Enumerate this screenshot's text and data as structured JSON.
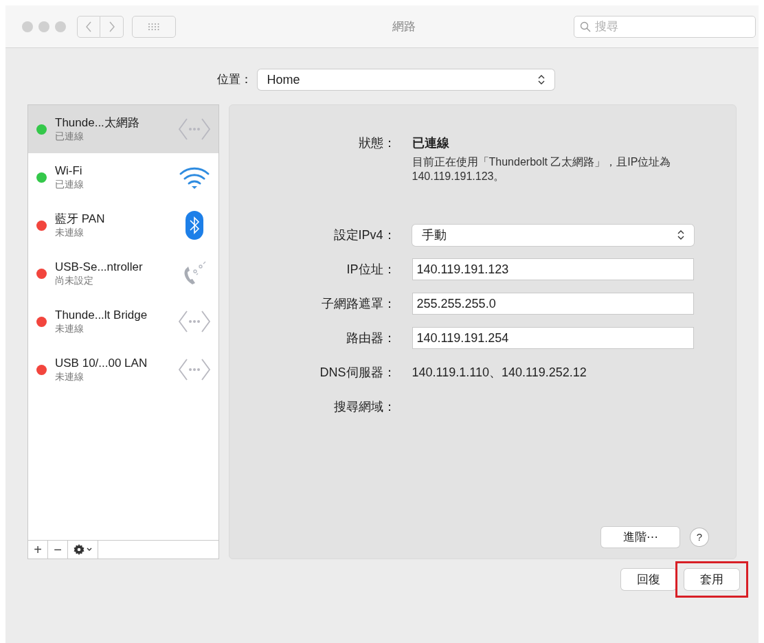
{
  "window": {
    "title": "網路",
    "search": {
      "placeholder": "搜尋"
    }
  },
  "location": {
    "label": "位置：",
    "value": "Home"
  },
  "services": [
    {
      "name": "Thunde...太網路",
      "status": "已連線",
      "color": "#34c84a",
      "selected": true,
      "kind": "ethernet"
    },
    {
      "name": "Wi-Fi",
      "status": "已連線",
      "color": "#34c84a",
      "selected": false,
      "kind": "wifi"
    },
    {
      "name": "藍牙 PAN",
      "status": "未連線",
      "color": "#f2453d",
      "selected": false,
      "kind": "bluetooth"
    },
    {
      "name": "USB-Se...ntroller",
      "status": "尚未設定",
      "color": "#f2453d",
      "selected": false,
      "kind": "phone"
    },
    {
      "name": "Thunde...lt Bridge",
      "status": "未連線",
      "color": "#f2453d",
      "selected": false,
      "kind": "ethernet"
    },
    {
      "name": "USB 10/...00 LAN",
      "status": "未連線",
      "color": "#f2453d",
      "selected": false,
      "kind": "ethernet"
    }
  ],
  "service_toolbar": [
    "+",
    "−"
  ],
  "detail": {
    "status_label": "狀態：",
    "status_value": "已連線",
    "description": "目前正在使用「Thunderbolt 乙太網路」，且IP位址為140.119.191.123。",
    "fields": [
      {
        "label": "設定IPv4：",
        "value": "手動",
        "kind": "select"
      },
      {
        "label": "IP位址：",
        "value": "140.119.191.123",
        "kind": "input"
      },
      {
        "label": "子網路遮罩：",
        "value": "255.255.255.0",
        "kind": "input"
      },
      {
        "label": "路由器：",
        "value": "140.119.191.254",
        "kind": "input"
      },
      {
        "label": "DNS伺服器：",
        "value": "140.119.1.110、140.119.252.12",
        "kind": "text"
      },
      {
        "label": "搜尋網域：",
        "kind": "text"
      }
    ],
    "advanced_button": "進階⋯",
    "help_button": "?"
  },
  "buttons": [
    {
      "label": "回復",
      "highlighted": false
    },
    {
      "label": "套用",
      "highlighted": true
    }
  ]
}
